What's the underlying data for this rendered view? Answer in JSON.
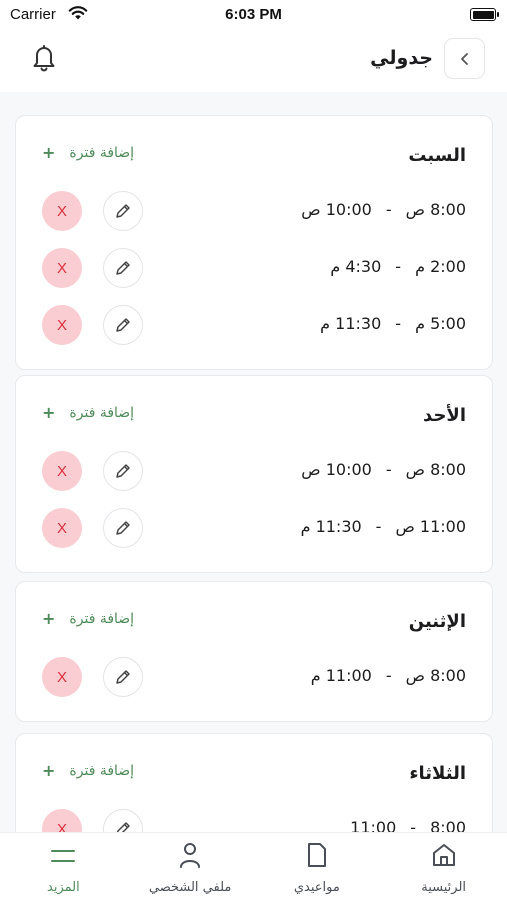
{
  "status_bar": {
    "carrier": "Carrier",
    "time": "6:03 PM"
  },
  "header": {
    "title": "جدولي"
  },
  "add_period_label": "إضافة فترة",
  "delete_label": "X",
  "days": [
    {
      "name": "السبت",
      "slots": [
        {
          "from": "8:00 ص",
          "to": "10:00 ص"
        },
        {
          "from": "2:00 م",
          "to": "4:30 م"
        },
        {
          "from": "5:00 م",
          "to": "11:30 م"
        }
      ]
    },
    {
      "name": "الأحد",
      "slots": [
        {
          "from": "8:00 ص",
          "to": "10:00 ص"
        },
        {
          "from": "11:00 ص",
          "to": "11:30 م"
        }
      ]
    },
    {
      "name": "الإثنين",
      "slots": [
        {
          "from": "8:00 ص",
          "to": "11:00 م"
        }
      ]
    },
    {
      "name": "الثلاثاء",
      "slots": [
        {
          "from": "8:00",
          "to": "11:00"
        }
      ]
    }
  ],
  "tabs": [
    {
      "label": "الرئيسية",
      "icon": "home-icon"
    },
    {
      "label": "مواعيدي",
      "icon": "document-icon"
    },
    {
      "label": "ملفي الشخصي",
      "icon": "user-icon"
    },
    {
      "label": "المزيد",
      "icon": "menu-icon",
      "active": true
    }
  ],
  "colors": {
    "accent": "#4f8a5a",
    "delete_bg": "#f9cdd2",
    "delete_fg": "#d9303f"
  }
}
